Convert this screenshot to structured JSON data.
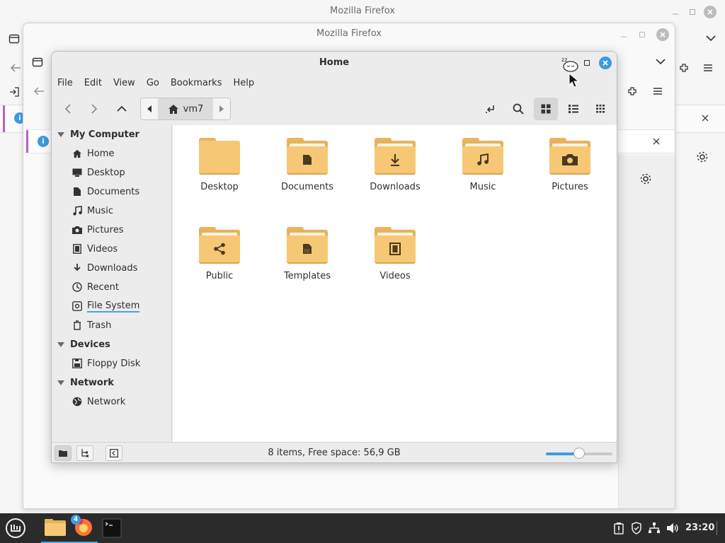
{
  "background_windows": {
    "firefox_back": {
      "title": "Mozilla Firefox",
      "partial_text": "I"
    },
    "firefox_mid": {
      "title": "Mozilla Firefox"
    }
  },
  "nemo": {
    "title": "Home",
    "menu": [
      "File",
      "Edit",
      "View",
      "Go",
      "Bookmarks",
      "Help"
    ],
    "path": {
      "crumb": "vm7"
    },
    "sidebar": {
      "sections": [
        {
          "label": "My Computer",
          "items": [
            {
              "label": "Home",
              "icon": "home-icon"
            },
            {
              "label": "Desktop",
              "icon": "desktop-icon"
            },
            {
              "label": "Documents",
              "icon": "document-icon"
            },
            {
              "label": "Music",
              "icon": "music-icon"
            },
            {
              "label": "Pictures",
              "icon": "camera-icon"
            },
            {
              "label": "Videos",
              "icon": "film-icon"
            },
            {
              "label": "Downloads",
              "icon": "download-icon"
            },
            {
              "label": "Recent",
              "icon": "clock-icon"
            },
            {
              "label": "File System",
              "icon": "drive-icon"
            },
            {
              "label": "Trash",
              "icon": "trash-icon"
            }
          ]
        },
        {
          "label": "Devices",
          "items": [
            {
              "label": "Floppy Disk",
              "icon": "floppy-icon"
            }
          ]
        },
        {
          "label": "Network",
          "items": [
            {
              "label": "Network",
              "icon": "globe-icon"
            }
          ]
        }
      ]
    },
    "files": [
      {
        "name": "Desktop",
        "emblem": "none"
      },
      {
        "name": "Documents",
        "emblem": "document-icon"
      },
      {
        "name": "Downloads",
        "emblem": "download-icon"
      },
      {
        "name": "Music",
        "emblem": "music-icon"
      },
      {
        "name": "Pictures",
        "emblem": "camera-icon"
      },
      {
        "name": "Public",
        "emblem": "share-icon"
      },
      {
        "name": "Templates",
        "emblem": "template-icon"
      },
      {
        "name": "Videos",
        "emblem": "film-icon"
      }
    ],
    "status": "8 items, Free space: 56,9 GB",
    "zoom_level": 0.5
  },
  "taskbar": {
    "firefox_badge": "4",
    "clock": "23:20"
  },
  "colors": {
    "accent": "#3d9be0",
    "folder": "#f6c875",
    "taskbar": "#2b2b2b"
  }
}
